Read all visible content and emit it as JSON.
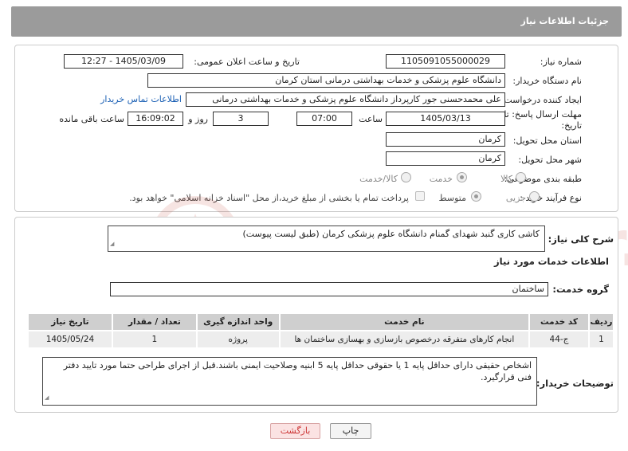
{
  "header": {
    "title": "جزئیات اطلاعات نیاز"
  },
  "fields": {
    "need_number_label": "شماره نیاز:",
    "need_number": "1105091055000029",
    "announce_label": "تاریخ و ساعت اعلان عمومی:",
    "announce_value": "1405/03/09 - 12:27",
    "buyer_label": "نام دستگاه خریدار:",
    "buyer_value": "دانشگاه علوم پزشکی و خدمات بهداشتی درمانی استان کرمان",
    "creator_label": "ایجاد کننده درخواست:",
    "creator_value": "علی محمدحسنی جور کارپرداز دانشگاه علوم پزشکی و خدمات بهداشتی درمانی",
    "contact_link": "اطلاعات تماس خریدار",
    "deadline_label": "مهلت ارسال پاسخ: تا تاریخ:",
    "deadline_date": "1405/03/13",
    "time_label": "ساعت",
    "deadline_time": "07:00",
    "days_value": "3",
    "days_label": "روز و",
    "remaining_time": "16:09:02",
    "remaining_label": "ساعت باقی مانده",
    "province_label": "استان محل تحویل:",
    "province_value": "کرمان",
    "city_label": "شهر محل تحویل:",
    "city_value": "کرمان",
    "category_label": "طبقه بندی موضوعی:",
    "category_options": [
      "کالا",
      "خدمت",
      "کالا/خدمت"
    ],
    "category_selected": "خدمت",
    "process_label": "نوع فرآیند خرید :",
    "process_options": [
      "جزیی",
      "متوسط"
    ],
    "process_selected": "متوسط",
    "payment_note": "پرداخت تمام یا بخشی از مبلغ خرید،از محل \"اسناد خزانه اسلامی\" خواهد بود."
  },
  "summary": {
    "label": "شرح کلی نیاز:",
    "text": "کاشی کاری گنبد شهدای گمنام دانشگاه علوم پزشکی کرمان (طبق لیست پیوست)"
  },
  "services": {
    "section_title": "اطلاعات خدمات مورد نیاز",
    "group_label": "گروه خدمت:",
    "group_value": "ساختمان",
    "columns": [
      "ردیف",
      "کد خدمت",
      "نام خدمت",
      "واحد اندازه گیری",
      "تعداد / مقدار",
      "تاریخ نیاز"
    ],
    "rows": [
      [
        "1",
        "ج-44",
        "انجام کارهای متفرقه درخصوص بازسازی و بهسازی ساختمان ها",
        "پروژه",
        "1",
        "1405/05/24"
      ]
    ]
  },
  "notes": {
    "label": "توضیحات خریدار:",
    "text": "اشخاص حقیقی دارای حداقل پایه 1 یا حقوقی حداقل پایه 5 ابنیه وصلاحیت ایمنی باشند.قبل از اجرای طراحی حتما مورد تایید دفتر فنی قرارگیرد."
  },
  "buttons": {
    "print": "چاپ",
    "back": "بازگشت"
  },
  "watermark_text": "AriaTender.neT",
  "colors": {
    "header_bg": "#9b9b9b",
    "link": "#1a5fb4",
    "back_btn_bg": "#fbe3e3",
    "watermark": "#c0392b"
  }
}
